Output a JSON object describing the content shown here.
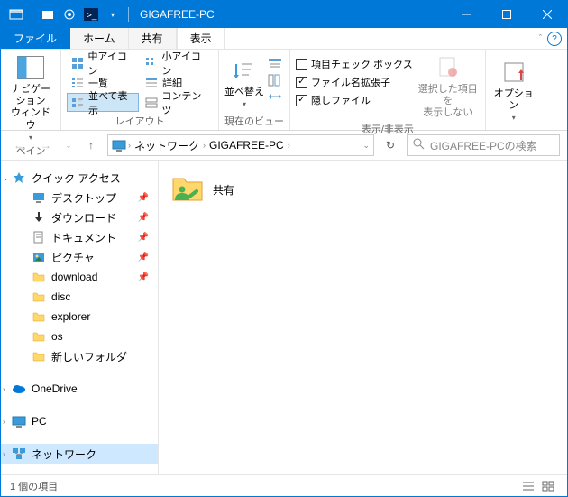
{
  "window_title": "GIGAFREE-PC",
  "tabs": {
    "file": "ファイル",
    "home": "ホーム",
    "share": "共有",
    "view": "表示"
  },
  "ribbon": {
    "pane_group": "ペイン",
    "nav_pane": "ナビゲーション\nウィンドウ",
    "layout_group": "レイアウト",
    "layout": {
      "medium": "中アイコン",
      "small": "小アイコン",
      "list": "一覧",
      "details": "詳細",
      "tiles": "並べて表示",
      "content": "コンテンツ"
    },
    "current_group": "現在のビュー",
    "sort": "並べ替え",
    "showhide_group": "表示/非表示",
    "checks": {
      "itemcheck": "項目チェック ボックス",
      "ext": "ファイル名拡張子",
      "hidden": "隠しファイル"
    },
    "hide_selected": "選択した項目を\n表示しない",
    "options": "オプション"
  },
  "breadcrumb": {
    "net": "ネットワーク",
    "pc": "GIGAFREE-PC"
  },
  "search_placeholder": "GIGAFREE-PCの検索",
  "nav": {
    "quick_access": "クイック アクセス",
    "desktop": "デスクトップ",
    "downloads": "ダウンロード",
    "documents": "ドキュメント",
    "pictures": "ピクチャ",
    "download": "download",
    "disc": "disc",
    "explorer": "explorer",
    "os": "os",
    "newfolder": "新しいフォルダ",
    "onedrive": "OneDrive",
    "pc": "PC",
    "network": "ネットワーク"
  },
  "content": {
    "share_folder": "共有"
  },
  "status_text": "1 個の項目"
}
